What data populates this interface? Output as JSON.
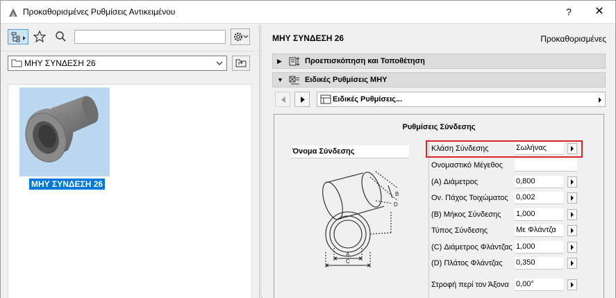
{
  "window": {
    "title": "Προκαθορισμένες Ρυθμίσεις Αντικειμένου",
    "help_label": "?",
    "close_label": "✕"
  },
  "left": {
    "search": {
      "value": "",
      "placeholder": ""
    },
    "folder": {
      "selected": "ΜΗΥ ΣΥΝΔΕΣΗ 26"
    },
    "items": [
      {
        "label": "ΜΗΥ ΣΥΝΔΕΣΗ 26",
        "selected": true
      }
    ]
  },
  "right": {
    "object_name": "ΜΗΥ ΣΥΝΔΕΣΗ 26",
    "defaults_label": "Προκαθορισμένες",
    "sections": [
      {
        "label": "Προεπισκόπηση και Τοποθέτηση",
        "expanded": false
      },
      {
        "label": "Ειδικές Ρυθμίσεις ΜΗΥ",
        "expanded": true
      }
    ],
    "page_selector": {
      "selected": "Ειδικές Ρυθμίσεις..."
    },
    "panel": {
      "title": "Ρυθμίσεις Σύνδεσης",
      "connection_name_label": "Όνομα Σύνδεσης",
      "diagram_labels": {
        "a": "A",
        "b": "B",
        "c": "C",
        "d": "D"
      },
      "params": [
        {
          "label": "Κλάση Σύνδεσης",
          "value": "Σωλήνας",
          "has_button": true,
          "highlighted": true
        },
        {
          "label": "Ονομαστικό Μέγεθος",
          "value": "",
          "has_button": false
        },
        {
          "label": "(A) Διάμετρος",
          "value": "0,800",
          "has_button": true
        },
        {
          "label": "Ον. Πάχος Τοιχώματος",
          "value": "0,002",
          "has_button": true
        },
        {
          "label": "(B) Μήκος Σύνδεσης",
          "value": "1,000",
          "has_button": true
        },
        {
          "label": "Τύπος Σύνδεσης",
          "value": "Με Φλάντζα",
          "has_button": true
        },
        {
          "label": "(C) Διάμετρος Φλάντζας",
          "value": "1,000",
          "has_button": true
        },
        {
          "label": "(D) Πλάτος Φλάντζας",
          "value": "0,350",
          "has_button": true
        },
        {
          "label": "Στροφή περί τον Άξονα",
          "value": "0,00°",
          "has_button": true
        }
      ]
    }
  },
  "colors": {
    "highlight": "#d9232d",
    "selection": "#0078d7",
    "thumb_bg": "#bcd8f0"
  }
}
